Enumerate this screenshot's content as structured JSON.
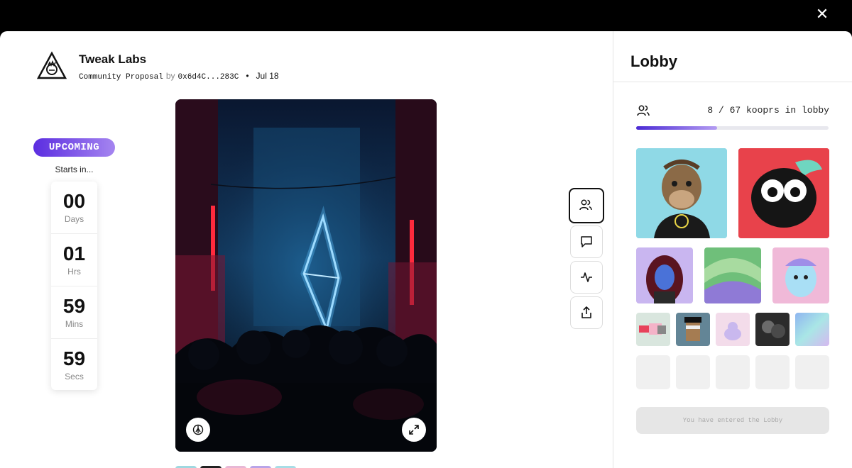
{
  "header": {
    "close_icon": "close-icon"
  },
  "proposal": {
    "org_name": "Tweak Labs",
    "type": "Community Proposal",
    "by_label": "by",
    "author": "0x6d4C...283C",
    "separator": "•",
    "date": "Jul 18"
  },
  "status": {
    "badge": "UPCOMING",
    "starts_label": "Starts in...",
    "countdown": [
      {
        "value": "00",
        "unit": "Days"
      },
      {
        "value": "01",
        "unit": "Hrs"
      },
      {
        "value": "59",
        "unit": "Mins"
      },
      {
        "value": "59",
        "unit": "Secs"
      }
    ]
  },
  "artwork": {
    "subject": "neon diamond light installation over crowd"
  },
  "side_actions": [
    "users-icon",
    "chat-icon",
    "activity-icon",
    "share-icon"
  ],
  "lobby": {
    "title": "Lobby",
    "count_text": "8 / 67 kooprs in lobby",
    "progress": 0.42,
    "entered_label": "You have entered the Lobby"
  },
  "colors": {
    "accent": "#5b2de0",
    "accent_light": "#b49cf2"
  }
}
